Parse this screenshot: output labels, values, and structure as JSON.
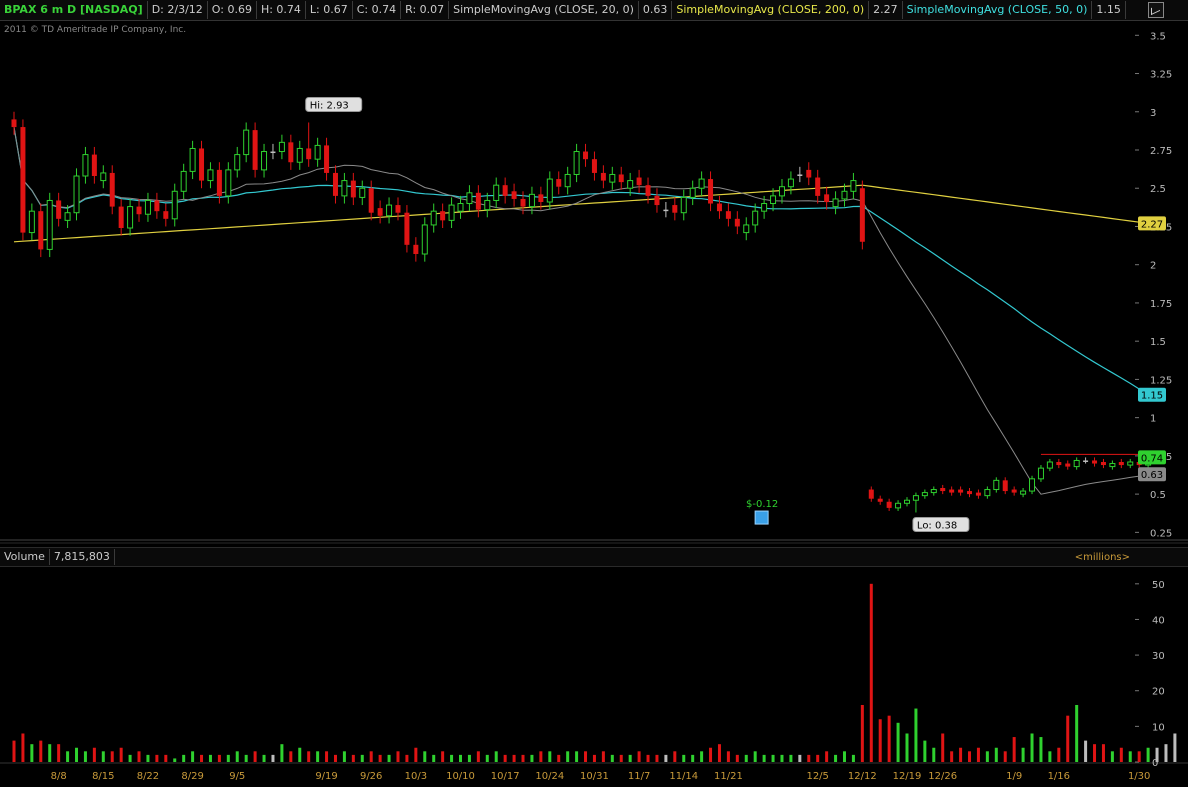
{
  "header": {
    "symbol": "BPAX 6 m D [NASDAQ]",
    "date": "D: 2/3/12",
    "open": "O: 0.69",
    "high": "H: 0.74",
    "low": "L: 0.67",
    "close": "C: 0.74",
    "range": "R: 0.07",
    "ma20_label": "SimpleMovingAvg (CLOSE, 20, 0)",
    "ma20_value": "0.63",
    "ma200_label": "SimpleMovingAvg (CLOSE, 200, 0)",
    "ma200_value": "2.27",
    "ma50_label": "SimpleMovingAvg (CLOSE, 50, 0)",
    "ma50_value": "1.15"
  },
  "copyright": "2011 © TD Ameritrade IP Company, Inc.",
  "volume_panel": {
    "label": "Volume",
    "value": "7,815,803",
    "units": "<millions>"
  },
  "colors": {
    "up": "#2fd12f",
    "down": "#e01414",
    "neutral": "#bdbdbd",
    "ma20": "#8a8a8a",
    "ma50": "#33c8d0",
    "ma200": "#e0d040",
    "resistance": "#e01414",
    "dates": "#c89a3a"
  },
  "chart_data": [
    {
      "type": "candlestick",
      "title": "BPAX 6 m D [NASDAQ]",
      "ylim": [
        0.2,
        3.6
      ],
      "y_ticks": [
        "3.5",
        "3.25",
        "3",
        "2.75",
        "2.5",
        "2.25",
        "2",
        "1.75",
        "1.5",
        "1.25",
        "1",
        "0.75",
        "0.5",
        "0.25"
      ],
      "y_tick_values": [
        3.5,
        3.25,
        3,
        2.75,
        2.5,
        2.25,
        2,
        1.75,
        1.5,
        1.25,
        1,
        0.75,
        0.5,
        0.25
      ],
      "x_labels": [
        "8/8",
        "8/15",
        "8/22",
        "8/29",
        "9/5",
        "9/19",
        "9/26",
        "10/3",
        "10/10",
        "10/17",
        "10/24",
        "10/31",
        "11/7",
        "11/14",
        "11/21",
        "12/5",
        "12/12",
        "12/19",
        "12/26",
        "1/9",
        "1/16",
        "1/30"
      ],
      "x_label_index": [
        5,
        10,
        15,
        20,
        25,
        35,
        40,
        45,
        50,
        55,
        60,
        65,
        70,
        75,
        80,
        90,
        95,
        100,
        104,
        112,
        117,
        126
      ],
      "closes": [
        2.9,
        2.21,
        2.35,
        2.1,
        2.42,
        2.3,
        2.34,
        2.58,
        2.72,
        2.58,
        2.6,
        2.38,
        2.24,
        2.38,
        2.33,
        2.42,
        2.35,
        2.3,
        2.48,
        2.61,
        2.76,
        2.55,
        2.62,
        2.45,
        2.62,
        2.72,
        2.88,
        2.62,
        2.74,
        2.74,
        2.8,
        2.67,
        2.76,
        2.69,
        2.78,
        2.6,
        2.45,
        2.55,
        2.44,
        2.5,
        2.34,
        2.32,
        2.39,
        2.34,
        2.13,
        2.07,
        2.26,
        2.35,
        2.29,
        2.39,
        2.4,
        2.47,
        2.36,
        2.42,
        2.52,
        2.45,
        2.43,
        2.38,
        2.46,
        2.41,
        2.56,
        2.51,
        2.59,
        2.74,
        2.69,
        2.6,
        2.55,
        2.59,
        2.54,
        2.55,
        2.52,
        2.45,
        2.39,
        2.36,
        2.34,
        2.44,
        2.5,
        2.56,
        2.4,
        2.35,
        2.3,
        2.25,
        2.26,
        2.35,
        2.4,
        2.45,
        2.51,
        2.56,
        2.59,
        2.57,
        2.45,
        2.41,
        2.43,
        2.48,
        2.55,
        2.15,
        0.47,
        0.45,
        0.41,
        0.44,
        0.46,
        0.49,
        0.51,
        0.53,
        0.52,
        0.51,
        0.51,
        0.5,
        0.49,
        0.53,
        0.59,
        0.52,
        0.51,
        0.52,
        0.6,
        0.67,
        0.71,
        0.69,
        0.68,
        0.72,
        0.72,
        0.7,
        0.69,
        0.7,
        0.69,
        0.71,
        0.69,
        0.74
      ],
      "candle_directions": [
        "down",
        "down",
        "up",
        "down",
        "up",
        "down",
        "up",
        "up",
        "up",
        "down",
        "up",
        "down",
        "down",
        "up",
        "down",
        "up",
        "down",
        "down",
        "up",
        "up",
        "up",
        "down",
        "up",
        "down",
        "up",
        "up",
        "up",
        "down",
        "up",
        "neutral",
        "up",
        "down",
        "up",
        "down",
        "up",
        "down",
        "down",
        "up",
        "down",
        "up",
        "down",
        "down",
        "up",
        "down",
        "down",
        "down",
        "up",
        "up",
        "down",
        "up",
        "up",
        "up",
        "down",
        "up",
        "up",
        "down",
        "down",
        "down",
        "up",
        "down",
        "up",
        "down",
        "up",
        "up",
        "down",
        "down",
        "down",
        "up",
        "down",
        "up",
        "down",
        "down",
        "down",
        "neutral",
        "down",
        "up",
        "up",
        "up",
        "down",
        "down",
        "down",
        "down",
        "up",
        "up",
        "up",
        "up",
        "up",
        "up",
        "neutral",
        "down",
        "down",
        "down",
        "up",
        "up",
        "up",
        "down",
        "down",
        "down",
        "down",
        "up",
        "up",
        "up",
        "up",
        "up",
        "down",
        "down",
        "down",
        "down",
        "down",
        "up",
        "up",
        "down",
        "down",
        "up",
        "up",
        "up",
        "up",
        "down",
        "down",
        "up",
        "neutral",
        "down",
        "down",
        "up",
        "down",
        "up",
        "down",
        "up"
      ],
      "series": [
        {
          "name": "SimpleMovingAvg (CLOSE, 20, 0)",
          "value": 0.63
        },
        {
          "name": "SimpleMovingAvg (CLOSE, 50, 0)",
          "value": 1.15
        },
        {
          "name": "SimpleMovingAvg (CLOSE, 200, 0)",
          "value": 2.27,
          "start": 2.15
        }
      ],
      "annotations": [
        {
          "text": "Hi: 2.93",
          "index": 33,
          "value": 2.93
        },
        {
          "text": "Lo: 0.38",
          "index": 101,
          "value": 0.38
        },
        {
          "text": "$-0.12",
          "index": 84,
          "value": 0.35
        }
      ],
      "resistance_line": {
        "value": 0.76,
        "from_index": 115,
        "to_index": 126
      },
      "last_price_badges": [
        {
          "text": "2.27",
          "value": 2.27,
          "color": "#e0d040"
        },
        {
          "text": "1.15",
          "value": 1.15,
          "color": "#33c8d0"
        },
        {
          "text": "0.74",
          "value": 0.74,
          "color": "#2fd12f"
        },
        {
          "text": "0.63",
          "value": 0.63,
          "color": "#8a8a8a"
        }
      ]
    },
    {
      "type": "bar",
      "title": "Volume",
      "units": "<millions>",
      "ylim": [
        0,
        55
      ],
      "y_ticks": [
        "50",
        "40",
        "30",
        "20",
        "10",
        "0"
      ],
      "y_tick_values": [
        50,
        40,
        30,
        20,
        10,
        0
      ],
      "values": [
        6,
        8,
        5,
        6,
        5,
        5,
        3,
        4,
        3,
        4,
        3,
        3,
        4,
        2,
        3,
        2,
        2,
        2,
        1,
        2,
        3,
        2,
        2,
        2,
        2,
        3,
        2,
        3,
        2,
        2,
        5,
        3,
        4,
        3,
        3,
        3,
        2,
        3,
        2,
        2,
        3,
        2,
        2,
        3,
        2,
        4,
        3,
        2,
        3,
        2,
        2,
        2,
        3,
        2,
        3,
        2,
        2,
        2,
        2,
        3,
        3,
        2,
        3,
        3,
        3,
        2,
        3,
        2,
        2,
        2,
        3,
        2,
        2,
        2,
        3,
        2,
        2,
        3,
        4,
        5,
        3,
        2,
        2,
        3,
        2,
        2,
        2,
        2,
        2,
        2,
        2,
        3,
        2,
        3,
        2,
        16,
        50,
        12,
        13,
        11,
        8,
        15,
        6,
        4,
        8,
        3,
        4,
        3,
        4,
        3,
        4,
        3,
        7,
        4,
        8,
        7,
        3,
        4,
        13,
        16,
        6,
        5,
        5,
        3,
        4,
        3,
        3,
        4,
        4,
        5,
        8
      ]
    }
  ]
}
